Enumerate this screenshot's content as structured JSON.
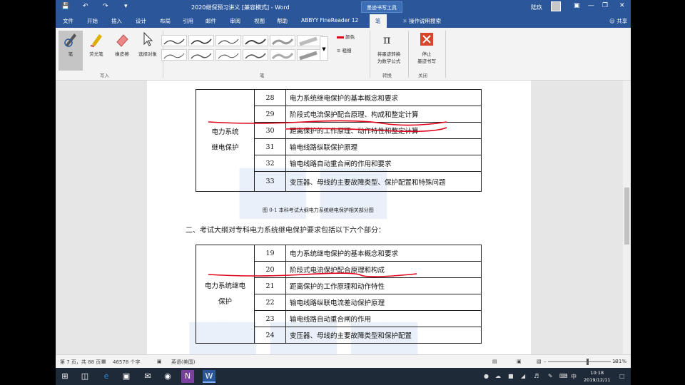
{
  "window": {
    "title": "2020继保预习讲义 [兼容模式] - Word",
    "context_tab": "墨迹书写工具",
    "user": "陆玖"
  },
  "tabs": [
    "文件",
    "开始",
    "插入",
    "设计",
    "布局",
    "引用",
    "邮件",
    "审阅",
    "视图",
    "帮助",
    "ABBYY FineReader 12",
    "笔"
  ],
  "active_tab": "笔",
  "tell_me": "操作说明搜索",
  "share": "共享",
  "ribbon": {
    "write_tools": {
      "pen": "笔",
      "highlighter": "荧光笔",
      "eraser": "橡皮擦",
      "select": "选择对象"
    },
    "write_group": "写入",
    "pens_group": "笔",
    "color_label": "颜色",
    "thickness_label": "粗细",
    "convert": {
      "line1": "将墨迹转换",
      "line2": "为数学公式"
    },
    "convert_group": "转换",
    "stop": {
      "line1": "停止",
      "line2": "墨迹书写"
    },
    "close_group": "关闭"
  },
  "document": {
    "table1": {
      "left_label_line1": "电力系统",
      "left_label_line2": "继电保护",
      "rows": [
        {
          "num": "28",
          "desc": "电力系统继电保护的基本概念和要求"
        },
        {
          "num": "29",
          "desc": "阶段式电流保护配合原理、构成和整定计算"
        },
        {
          "num": "30",
          "desc": "距离保护的工作原理、动作特性和整定计算"
        },
        {
          "num": "31",
          "desc": "输电线路纵联保护原理"
        },
        {
          "num": "32",
          "desc": "输电线路自动重合闸的作用和要求"
        },
        {
          "num": "33",
          "desc": "变压器、母线的主要故障类型、保护配置和特殊问题"
        }
      ],
      "caption": "图 0-1    本科考试大纲电力系统继电保护相关部分图"
    },
    "paragraph": "二、考试大纲对专科电力系统继电保护要求包括以下六个部分：",
    "table2": {
      "left_label_line1": "电力系统继电",
      "left_label_line2": "保护",
      "rows": [
        {
          "num": "19",
          "desc": "电力系统继电保护的基本概念和要求"
        },
        {
          "num": "20",
          "desc": "阶段式电流保护配合原理和构成"
        },
        {
          "num": "21",
          "desc": "距离保护的工作原理和动作特性"
        },
        {
          "num": "22",
          "desc": "输电线路纵联电流差动保护原理"
        },
        {
          "num": "23",
          "desc": "输电线路自动重合闸的作用"
        },
        {
          "num": "24",
          "desc": "变压器、母线的主要故障类型和保护配置"
        }
      ]
    }
  },
  "status": {
    "page": "第 7 页，共 88 页",
    "words": "46578 个字",
    "language": "英语(美国)",
    "zoom": "131%"
  },
  "taskbar": {
    "time": "10:18",
    "date": "2019/12/11",
    "ime": "中"
  },
  "colors": {
    "accent": "#2b579a",
    "ink": "#e0001a"
  }
}
